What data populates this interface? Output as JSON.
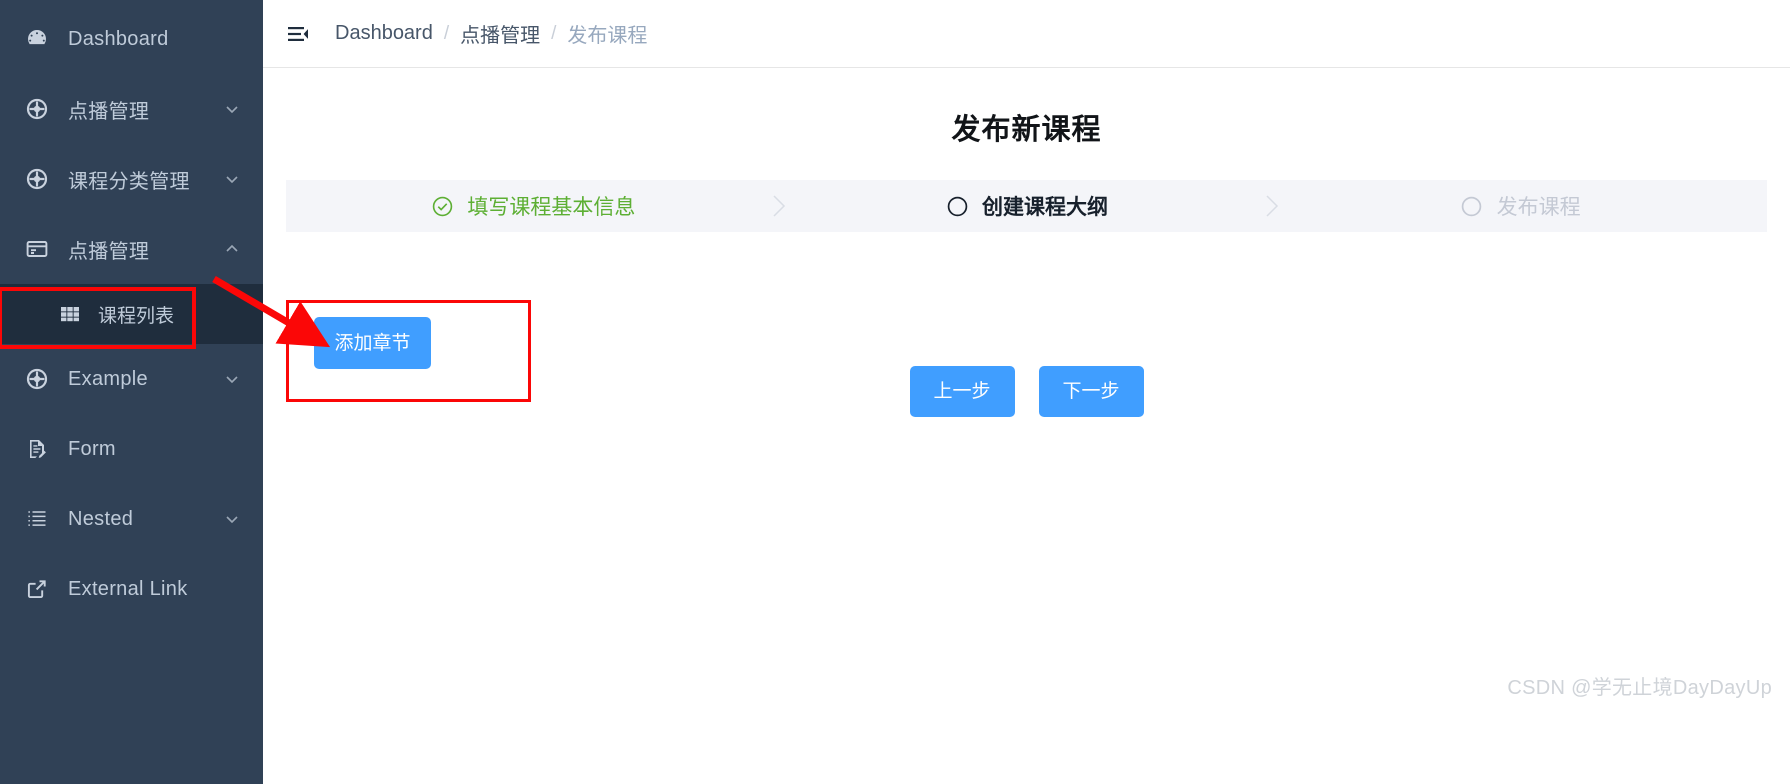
{
  "sidebar": {
    "items": [
      {
        "label": "Dashboard",
        "icon": "dashboard-icon",
        "expandable": false,
        "expanded": false
      },
      {
        "label": "点播管理",
        "icon": "compass-icon",
        "expandable": true,
        "expanded": false
      },
      {
        "label": "课程分类管理",
        "icon": "compass-icon",
        "expandable": true,
        "expanded": false
      },
      {
        "label": "点播管理",
        "icon": "card-icon",
        "expandable": true,
        "expanded": true
      },
      {
        "label": "Example",
        "icon": "compass-icon",
        "expandable": true,
        "expanded": false
      },
      {
        "label": "Form",
        "icon": "form-icon",
        "expandable": false,
        "expanded": false
      },
      {
        "label": "Nested",
        "icon": "nested-list-icon",
        "expandable": true,
        "expanded": false
      },
      {
        "label": "External Link",
        "icon": "external-link-icon",
        "expandable": false,
        "expanded": false
      }
    ],
    "sub_items": [
      {
        "label": "课程列表",
        "icon": "table-icon",
        "active": true,
        "highlighted": true
      }
    ],
    "background_color": "#304156",
    "active_background_color": "#1f2d3d"
  },
  "topbar": {
    "hamburger_icon": "hamburger-menu-icon",
    "breadcrumb": [
      {
        "label": "Dashboard",
        "muted": false
      },
      {
        "label": "点播管理",
        "muted": false
      },
      {
        "label": "发布课程",
        "muted": true
      }
    ],
    "separator": "/"
  },
  "page": {
    "title": "发布新课程"
  },
  "steps": {
    "items": [
      {
        "label": "填写课程基本信息",
        "state": "done",
        "icon": "check-circle-icon"
      },
      {
        "label": "创建课程大纲",
        "state": "active",
        "icon": "circle-icon"
      },
      {
        "label": "发布课程",
        "state": "wait",
        "icon": "circle-icon"
      }
    ],
    "done_color": "#5daf34",
    "active_color": "#17202c",
    "wait_color": "#c4c9d4",
    "background_color": "#f4f5f9"
  },
  "content": {
    "add_chapter_label": "添加章节",
    "prev_label": "上一步",
    "next_label": "下一步",
    "primary_button_color": "#409eff",
    "annotation_color": "#fb0707"
  },
  "watermark": {
    "text": "CSDN @学无止境DayDayUp"
  }
}
